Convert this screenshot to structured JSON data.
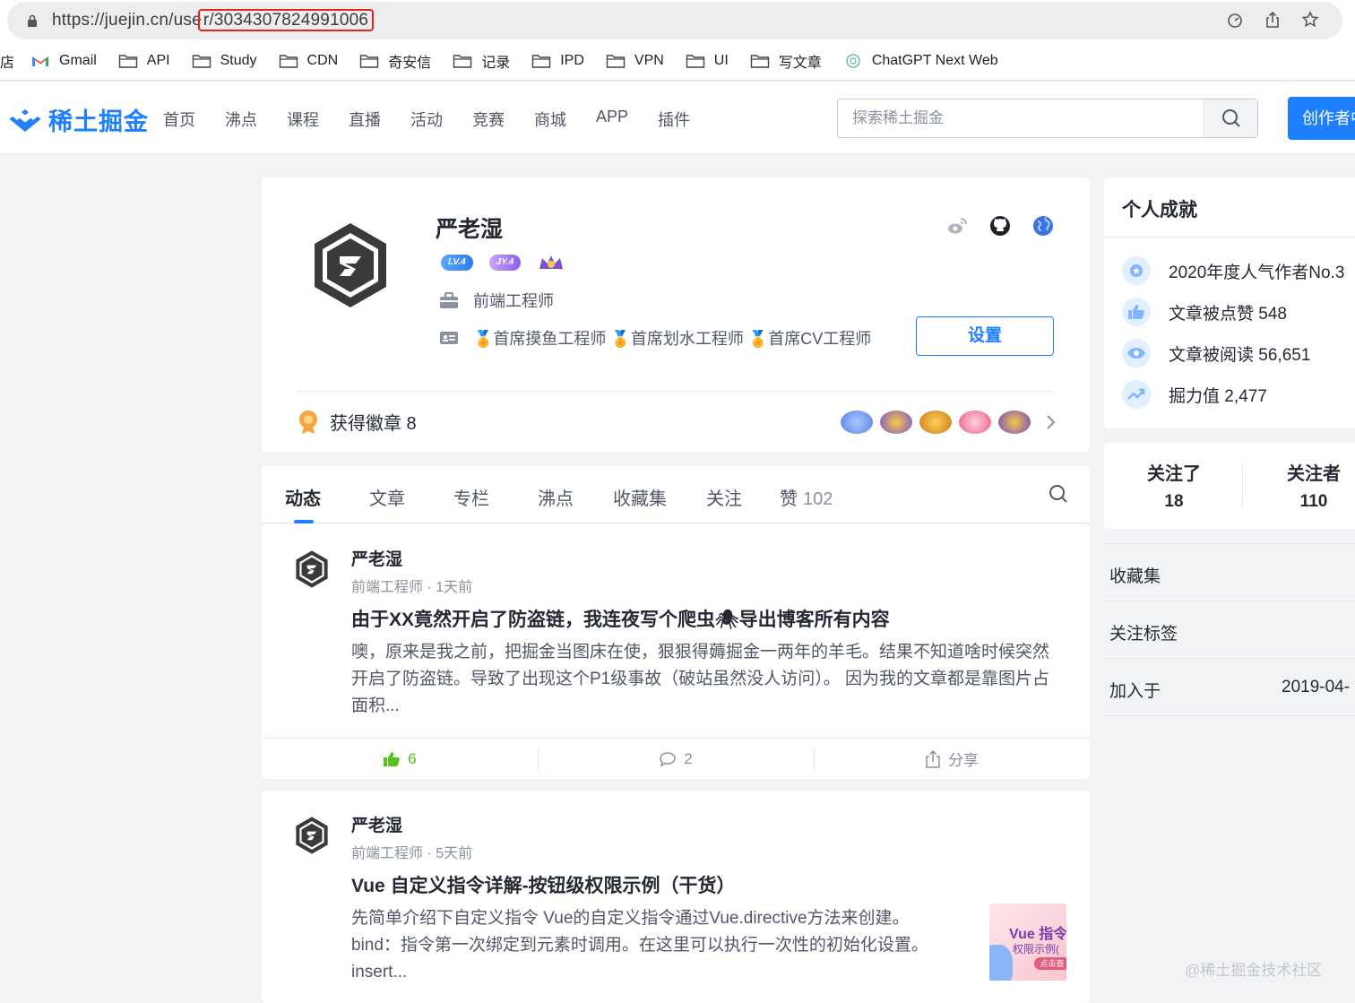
{
  "browser": {
    "url_prefix": "https://juejin.cn/use",
    "url_highlight": "r/3034307824991006"
  },
  "bookmarks": [
    {
      "label": "店",
      "icon": "none"
    },
    {
      "label": "Gmail",
      "icon": "gmail-icon"
    },
    {
      "label": "API",
      "icon": "folder-icon"
    },
    {
      "label": "Study",
      "icon": "folder-icon"
    },
    {
      "label": "CDN",
      "icon": "folder-icon"
    },
    {
      "label": "奇安信",
      "icon": "folder-icon"
    },
    {
      "label": "记录",
      "icon": "folder-icon"
    },
    {
      "label": "IPD",
      "icon": "folder-icon"
    },
    {
      "label": "VPN",
      "icon": "folder-icon"
    },
    {
      "label": "UI",
      "icon": "folder-icon"
    },
    {
      "label": "写文章",
      "icon": "folder-icon"
    },
    {
      "label": "ChatGPT Next Web",
      "icon": "openai-icon"
    }
  ],
  "header": {
    "logo": "稀土掘金",
    "nav": [
      "首页",
      "沸点",
      "课程",
      "直播",
      "活动",
      "竞赛",
      "商城",
      "APP",
      "插件"
    ],
    "search_placeholder": "探索稀土掘金",
    "create_label": "创作者中心",
    "brand_color": "#1e80ff"
  },
  "profile": {
    "name": "严老湿",
    "level_badge": "LV.4",
    "jy_badge": "JY.4",
    "job": "前端工程师",
    "titles": "🏅首席摸鱼工程师 🏅首席划水工程师 🏅首席CV工程师",
    "settings_label": "设置",
    "badges_label": "获得徽章 8"
  },
  "tabs": {
    "items": [
      "动态",
      "文章",
      "专栏",
      "沸点",
      "收藏集",
      "关注",
      "赞"
    ],
    "like_count": "102",
    "active": "动态"
  },
  "feed": [
    {
      "author": "严老湿",
      "meta": "前端工程师 · 1天前",
      "title": "由于XX竟然开启了防盗链，我连夜写个爬虫🕷导出博客所有内容",
      "abstract": "噢，原来是我之前，把掘金当图床在使，狠狠得薅掘金一两年的羊毛。结果不知道啥时候突然开启了防盗链。导致了出现这个P1级事故（破站虽然没人访问）。 因为我的文章都是靠图片占面积...",
      "likes": "6",
      "comments": "2",
      "share_label": "分享"
    },
    {
      "author": "严老湿",
      "meta": "前端工程师 · 5天前",
      "title": "Vue 自定义指令详解-按钮级权限示例（干货）",
      "abstract": "先简单介绍下自定义指令 Vue的自定义指令通过Vue.directive方法来创建。 bind：指令第一次绑定到元素时调用。在这里可以执行一次性的初始化设置。 insert...",
      "thumb_title": "Vue 指令",
      "thumb_sub": "权限示例(",
      "thumb_btn": "点击查"
    }
  ],
  "sidebar": {
    "achievements_title": "个人成就",
    "achievements": [
      {
        "icon": "medal-icon",
        "text": "2020年度人气作者No.3"
      },
      {
        "icon": "thumbs-up-icon",
        "text": "文章被点赞 548"
      },
      {
        "icon": "eye-icon",
        "text": "文章被阅读 56,651"
      },
      {
        "icon": "trend-icon",
        "text": "掘力值 2,477"
      }
    ],
    "following_label": "关注了",
    "following_count": "18",
    "followers_label": "关注者",
    "followers_count": "110",
    "collections_label": "收藏集",
    "tags_label": "关注标签",
    "joined_label": "加入于",
    "joined_value": "2019-04-"
  },
  "watermark": "@稀土掘金技术社区"
}
